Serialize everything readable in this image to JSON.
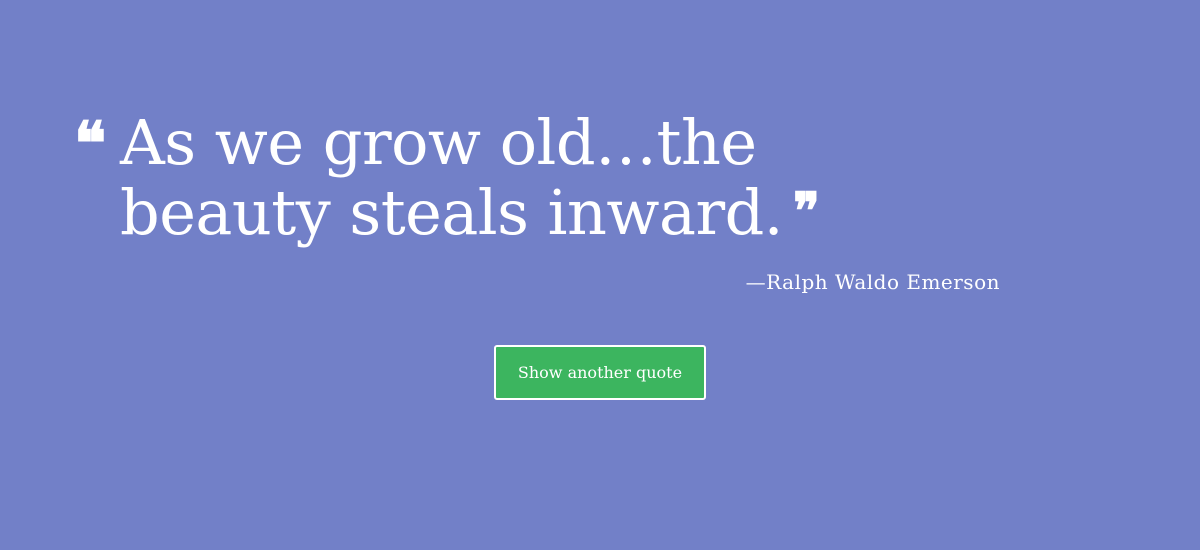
{
  "quote": {
    "open_mark": "❝",
    "text": "As we grow old…the beauty steals inward.",
    "close_mark": "❞",
    "author": "—Ralph Waldo Emerson"
  },
  "actions": {
    "new_quote_label": "Show another quote"
  },
  "colors": {
    "background": "#7280c8",
    "button": "#3cb55f",
    "text": "#ffffff"
  }
}
